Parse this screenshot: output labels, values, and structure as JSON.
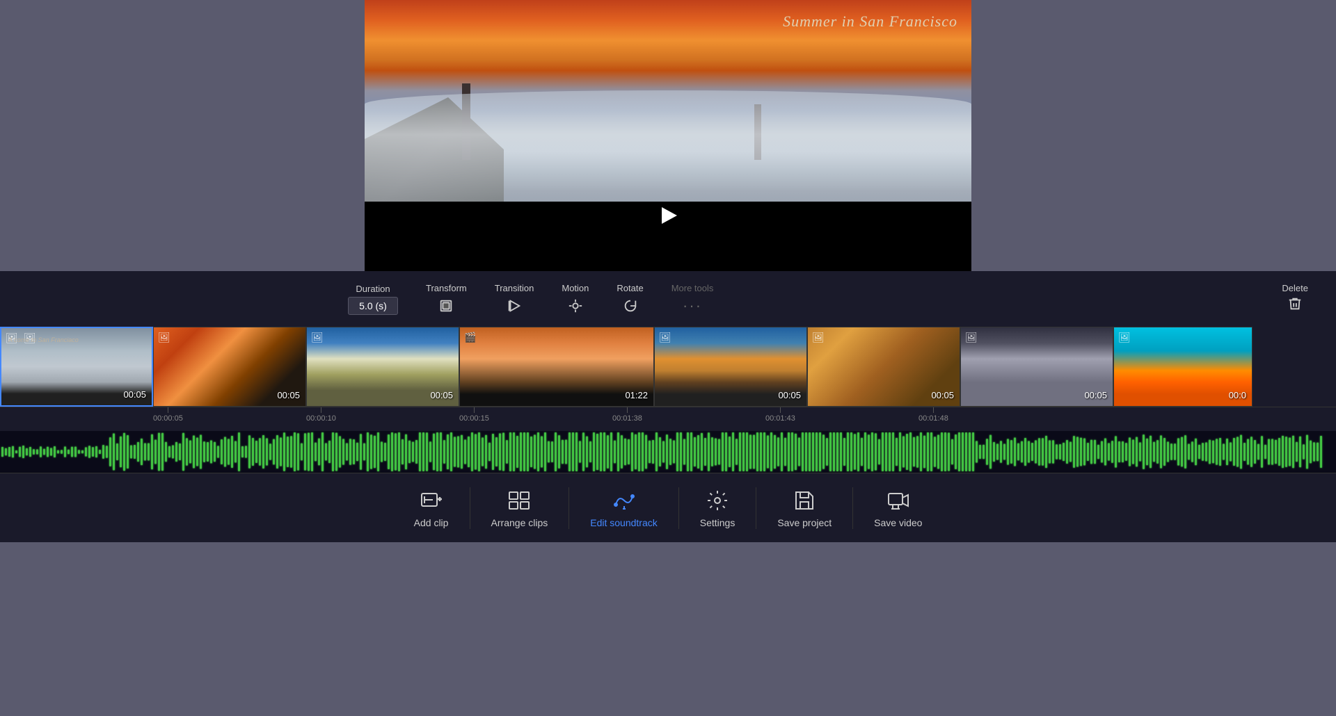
{
  "video": {
    "title": "Summer in San Francisco",
    "play_button_label": "Play"
  },
  "toolbar": {
    "duration_label": "Duration",
    "duration_value": "5.0 (s)",
    "transform_label": "Transform",
    "transition_label": "Transition",
    "motion_label": "Motion",
    "rotate_label": "Rotate",
    "more_tools_label": "More tools",
    "delete_label": "Delete"
  },
  "clips": [
    {
      "id": 1,
      "duration": "00:05",
      "type": "image",
      "selected": true
    },
    {
      "id": 2,
      "duration": "00:05",
      "type": "image",
      "selected": false
    },
    {
      "id": 3,
      "duration": "00:05",
      "type": "image",
      "selected": false
    },
    {
      "id": 4,
      "duration": "01:22",
      "type": "video",
      "selected": false
    },
    {
      "id": 5,
      "duration": "00:05",
      "type": "image",
      "selected": false
    },
    {
      "id": 6,
      "duration": "00:05",
      "type": "image",
      "selected": false
    },
    {
      "id": 7,
      "duration": "00:05",
      "type": "image",
      "selected": false
    },
    {
      "id": 8,
      "duration": "00:0",
      "type": "image",
      "selected": false
    }
  ],
  "ruler": {
    "marks": [
      {
        "time": "00:00:05",
        "position": 220
      },
      {
        "time": "00:00:10",
        "position": 440
      },
      {
        "time": "00:00:15",
        "position": 660
      },
      {
        "time": "00:01:38",
        "position": 880
      },
      {
        "time": "00:01:43",
        "position": 1100
      },
      {
        "time": "00:01:48",
        "position": 1320
      }
    ]
  },
  "bottom_toolbar": {
    "items": [
      {
        "id": "add-clip",
        "label": "Add clip",
        "icon": "add-clip-icon"
      },
      {
        "id": "arrange-clips",
        "label": "Arrange clips",
        "icon": "arrange-icon"
      },
      {
        "id": "edit-soundtrack",
        "label": "Edit soundtrack",
        "icon": "soundtrack-icon",
        "active": true
      },
      {
        "id": "settings",
        "label": "Settings",
        "icon": "settings-icon"
      },
      {
        "id": "save-project",
        "label": "Save project",
        "icon": "save-icon"
      },
      {
        "id": "save-video",
        "label": "Save video",
        "icon": "save-video-icon"
      }
    ]
  }
}
